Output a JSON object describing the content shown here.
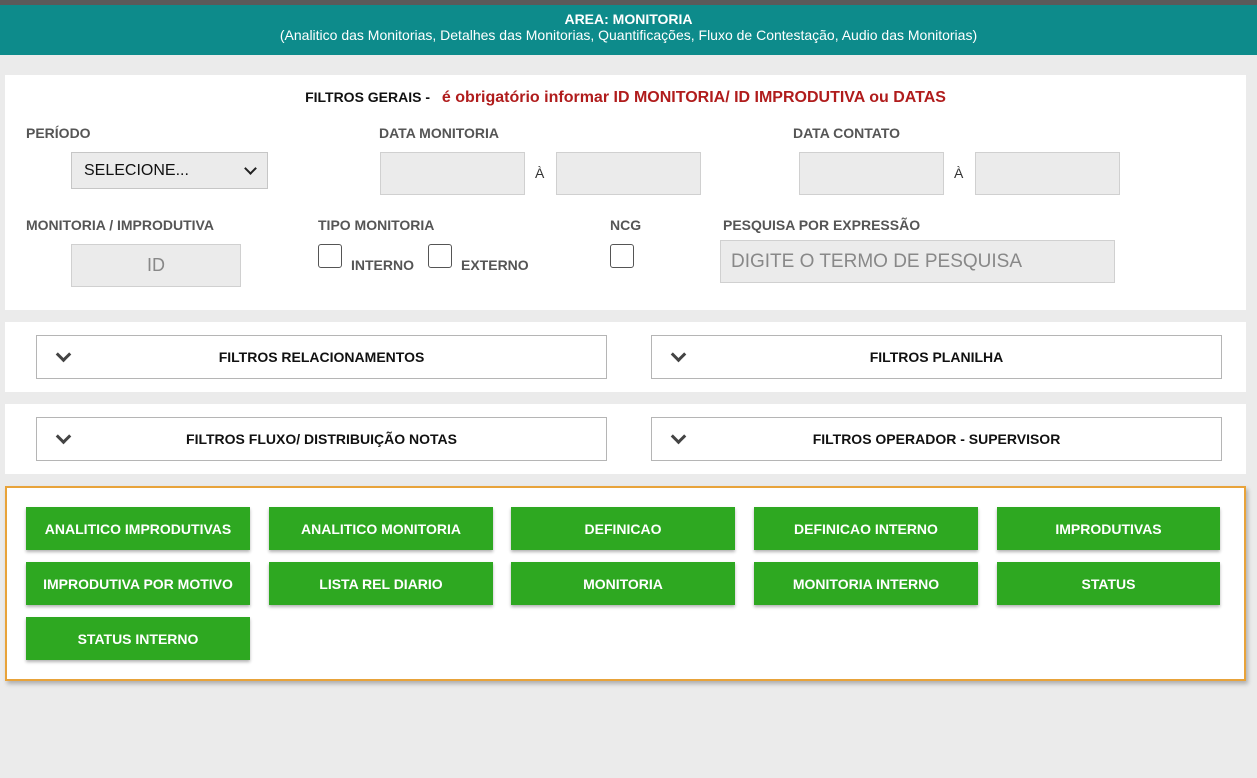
{
  "header": {
    "title": "AREA: MONITORIA",
    "subtitle": "(Analitico das Monitorias, Detalhes das Monitorias, Quantificações, Fluxo de Contestação, Audio das Monitorias)",
    "background_color": "#0d8b8b"
  },
  "general_filters": {
    "title": "FILTROS GERAIS -",
    "required_notice": "é obrigatório informar ID MONITORIA/ ID IMPRODUTIVA ou DATAS",
    "periodo_label": "PERÍODO",
    "periodo_value": "SELECIONE...",
    "data_monitoria_label": "DATA MONITORIA",
    "data_contato_label": "DATA CONTATO",
    "range_separator": "À",
    "monitoria_improdutiva_label": "MONITORIA / IMPRODUTIVA",
    "id_placeholder": "ID",
    "tipo_monitoria_label": "TIPO MONITORIA",
    "interno_label": "INTERNO",
    "externo_label": "EXTERNO",
    "ncg_label": "NCG",
    "pesquisa_label": "PESQUISA POR EXPRESSÃO",
    "pesquisa_placeholder": "DIGITE O TERMO DE PESQUISA"
  },
  "accordions": {
    "relacionamentos": "FILTROS RELACIONAMENTOS",
    "planilha": "FILTROS PLANILHA",
    "fluxo": "FILTROS FLUXO/ DISTRIBUIÇÃO NOTAS",
    "operador": "FILTROS OPERADOR - SUPERVISOR"
  },
  "reports": {
    "button_color": "#2ea821",
    "border_color": "#e8a33a",
    "buttons": [
      "ANALITICO IMPRODUTIVAS",
      "ANALITICO MONITORIA",
      "DEFINICAO",
      "DEFINICAO INTERNO",
      "IMPRODUTIVAS",
      "IMPRODUTIVA POR MOTIVO",
      "LISTA REL DIARIO",
      "MONITORIA",
      "MONITORIA INTERNO",
      "STATUS",
      "STATUS INTERNO"
    ]
  }
}
